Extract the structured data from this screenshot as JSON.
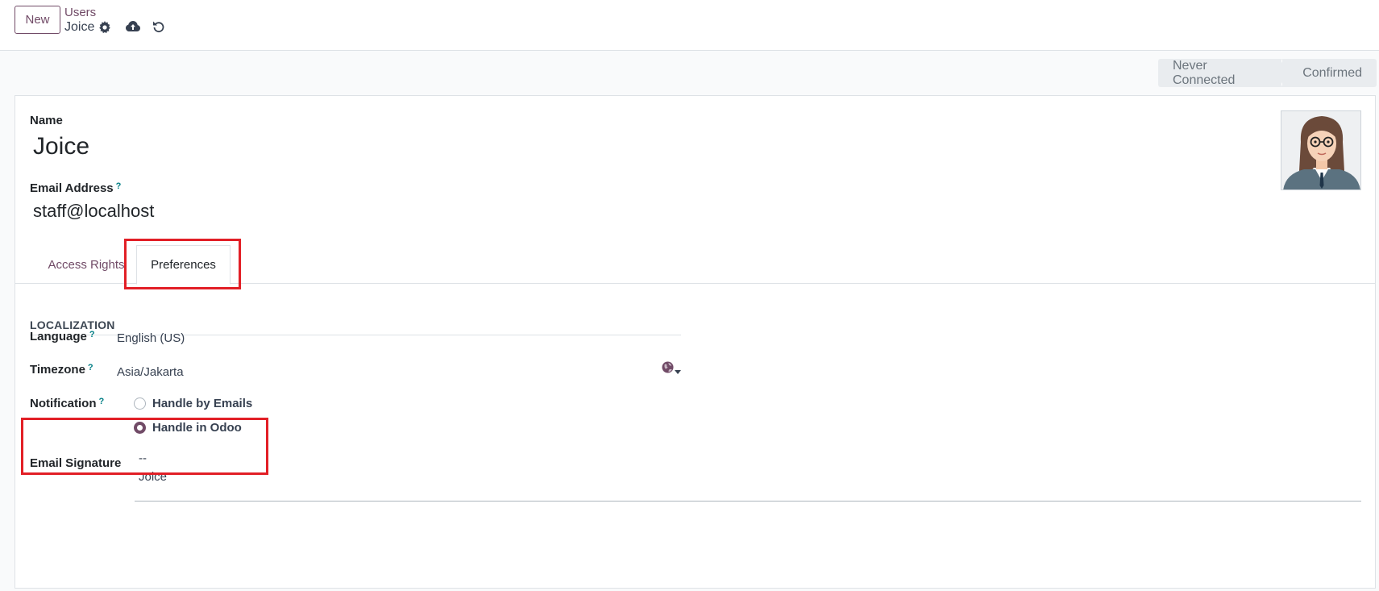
{
  "control_panel": {
    "new_button": "New",
    "breadcrumb_parent": "Users",
    "breadcrumb_current": "Joice",
    "icons": [
      "gear-icon",
      "cloud-upload-icon",
      "undo-icon"
    ]
  },
  "statusbar": {
    "stages": [
      "Never Connected",
      "Confirmed"
    ]
  },
  "form": {
    "name_label": "Name",
    "name_value": "Joice",
    "email_label": "Email Address",
    "email_help": "?",
    "email_value": "staff@localhost",
    "tabs": [
      {
        "label": "Access Rights",
        "active": false
      },
      {
        "label": "Preferences",
        "active": true
      }
    ],
    "section_title": "LOCALIZATION",
    "language_label": "Language",
    "language_help": "?",
    "language_value": "English (US)",
    "timezone_label": "Timezone",
    "timezone_help": "?",
    "timezone_value": "Asia/Jakarta",
    "notification_label": "Notification",
    "notification_help": "?",
    "notification_options": [
      {
        "label": "Handle by Emails",
        "checked": false
      },
      {
        "label": "Handle in Odoo",
        "checked": true
      }
    ],
    "signature_label": "Email Signature",
    "signature_lines": [
      "--",
      "Joice"
    ]
  },
  "colors": {
    "brand": "#714b67",
    "help": "#017e84",
    "highlight": "#e21f26"
  }
}
